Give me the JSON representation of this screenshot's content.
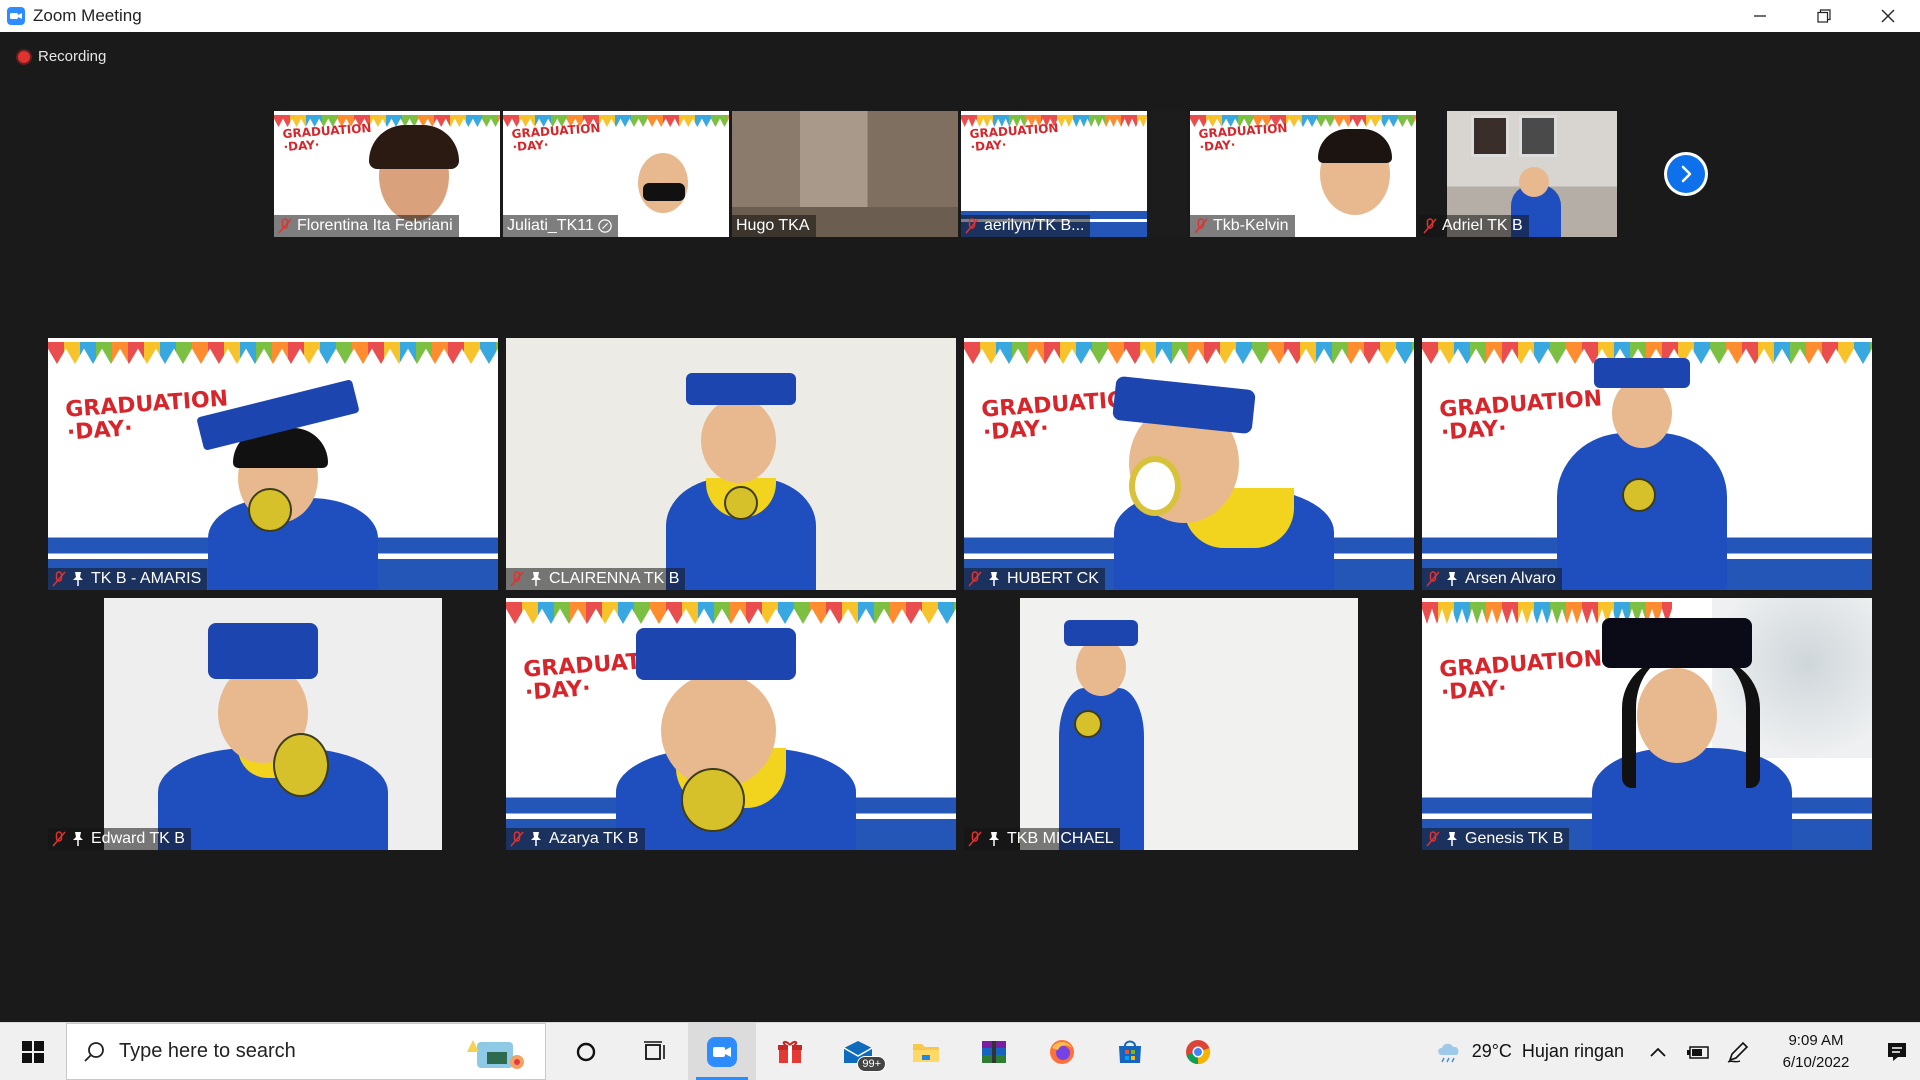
{
  "window": {
    "title": "Zoom Meeting"
  },
  "meeting": {
    "recording_label": "Recording",
    "strip_participants": [
      {
        "name": "Florentina Ita Febriani"
      },
      {
        "name": "Juliati_TK11"
      },
      {
        "name": "Hugo TKA"
      },
      {
        "name": "aerilyn/TK B..."
      },
      {
        "name": "Tkb-Kelvin"
      },
      {
        "name": "Adriel TK B"
      }
    ],
    "grid_participants": [
      {
        "name": "TK B - AMARIS"
      },
      {
        "name": "CLAIRENNA TK B"
      },
      {
        "name": "HUBERT CK"
      },
      {
        "name": "Arsen Alvaro"
      },
      {
        "name": "Edward TK B"
      },
      {
        "name": "Azarya TK B"
      },
      {
        "name": "TKB MICHAEL"
      },
      {
        "name": "Genesis TK B"
      }
    ],
    "background_text": {
      "line1": "GRADUATION",
      "line2": "·DAY·"
    }
  },
  "taskbar": {
    "search_placeholder": "Type here to search",
    "mail_badge": "99+",
    "weather": {
      "temp": "29°C",
      "condition": "Hujan ringan"
    },
    "clock": {
      "time": "9:09 AM",
      "date": "6/10/2022"
    }
  },
  "colors": {
    "zoom_blue": "#2d8cff",
    "recording_red": "#e0322f",
    "next_button": "#0e71eb"
  }
}
